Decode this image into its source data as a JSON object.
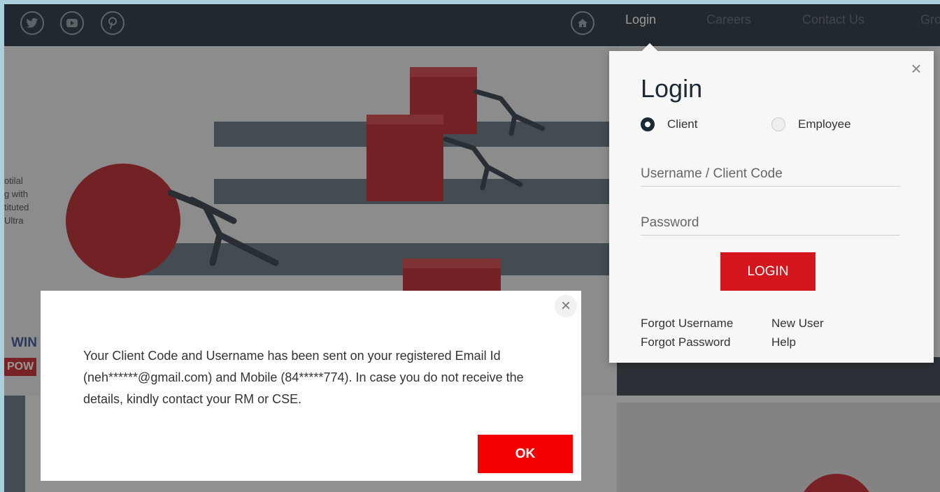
{
  "topbar": {
    "social_icons": [
      "twitter-icon",
      "youtube-icon",
      "pinterest-icon"
    ],
    "home_icon": "home-icon",
    "nav": [
      {
        "label": "Login",
        "active": true
      },
      {
        "label": "Careers",
        "active": false
      },
      {
        "label": "Contact Us",
        "active": false
      },
      {
        "label": "Gro",
        "active": false
      }
    ]
  },
  "hero": {
    "side_text": "otilal\ng with\ntituted\nUltra",
    "brand_line": "WIN",
    "brand_badge": "POW"
  },
  "login_panel": {
    "title": "Login",
    "close_icon": "close-icon",
    "radio_client": "Client",
    "radio_employee": "Employee",
    "selected": "Client",
    "username_placeholder": "Username / Client Code",
    "password_placeholder": "Password",
    "login_button": "LOGIN",
    "forgot_username": "Forgot Username",
    "new_user": "New User",
    "forgot_password": "Forgot Password",
    "help": "Help"
  },
  "dialog": {
    "message": "Your Client Code and Username has been sent on your registered Email Id (neh******@gmail.com) and Mobile (84*****774). In case you do not receive the details, kindly contact your RM or CSE.",
    "ok_button": "OK",
    "close_icon": "close-icon"
  },
  "colors": {
    "nav_bg": "#1b2a35",
    "accent_red": "#d4161d",
    "ok_red": "#f40000",
    "frame": "#a9cfdc"
  }
}
